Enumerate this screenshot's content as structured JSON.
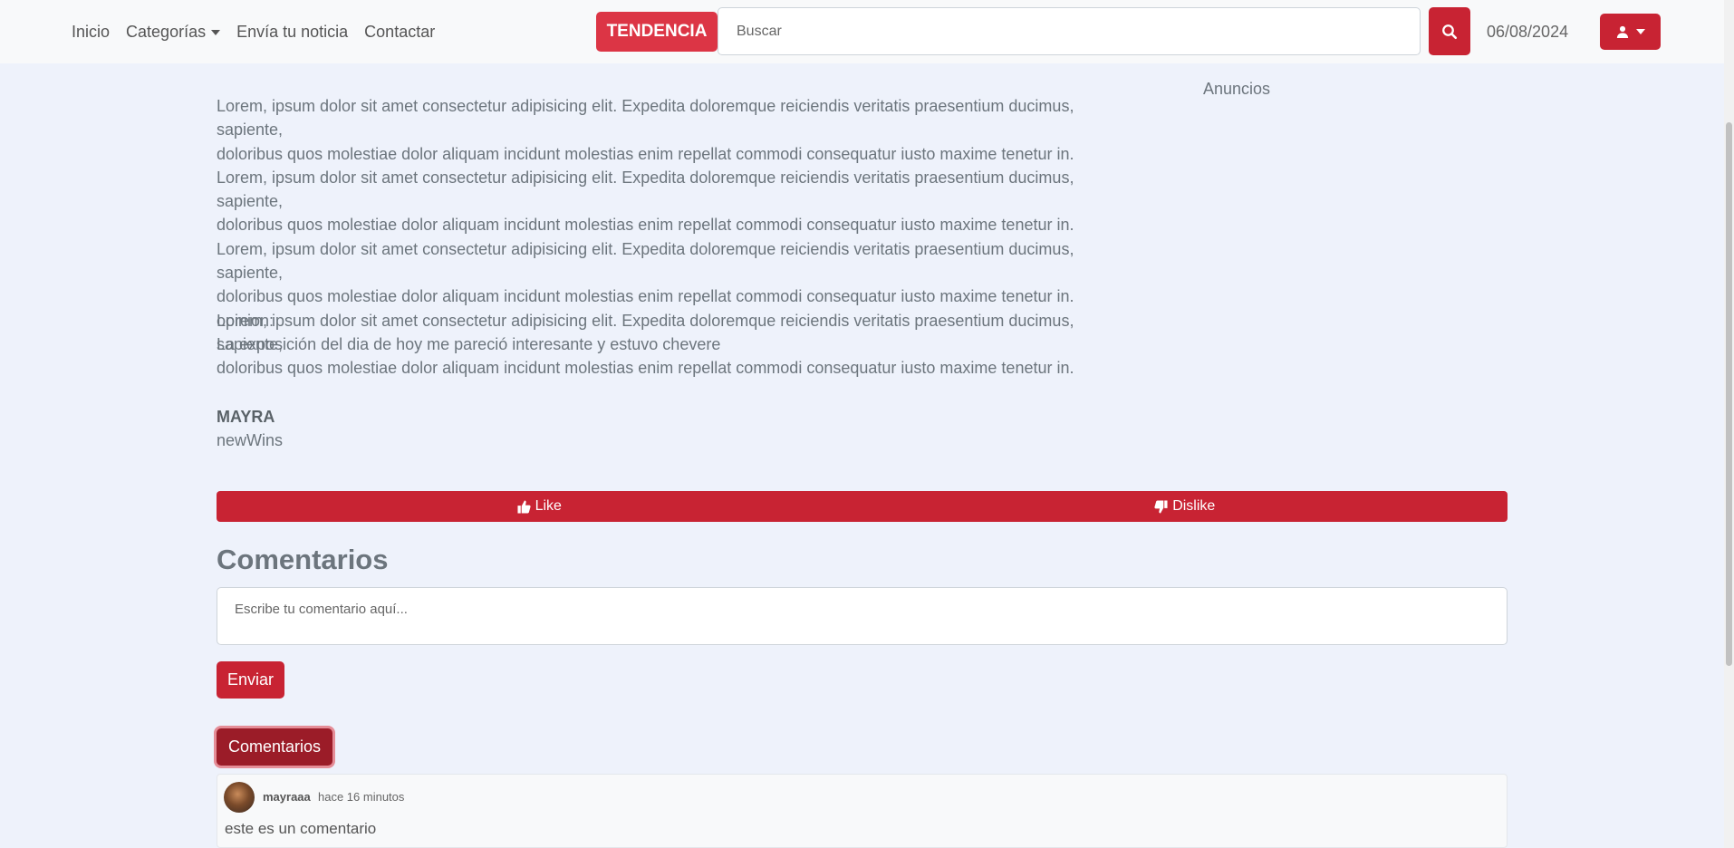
{
  "nav": {
    "links": [
      "Inicio",
      "Categorías",
      "Envía tu noticia",
      "Contactar"
    ],
    "trending_label": "TENDENCIA",
    "search_placeholder": "Buscar",
    "date": "06/08/2024"
  },
  "article": {
    "paragraph_lines": [
      "Lorem, ipsum dolor sit amet consectetur adipisicing elit. Expedita doloremque reiciendis veritatis praesentium ducimus, sapiente,",
      "doloribus quos molestiae dolor aliquam incidunt molestias enim repellat commodi consequatur iusto maxime tenetur in.",
      "Lorem, ipsum dolor sit amet consectetur adipisicing elit. Expedita doloremque reiciendis veritatis praesentium ducimus, sapiente,",
      "doloribus quos molestiae dolor aliquam incidunt molestias enim repellat commodi consequatur iusto maxime tenetur in.",
      "Lorem, ipsum dolor sit amet consectetur adipisicing elit. Expedita doloremque reiciendis veritatis praesentium ducimus, sapiente,",
      "doloribus quos molestiae dolor aliquam incidunt molestias enim repellat commodi consequatur iusto maxime tenetur in.",
      "Lorem, ipsum dolor sit amet consectetur adipisicing elit. Expedita doloremque reiciendis veritatis praesentium ducimus, sapiente,",
      "doloribus quos molestiae dolor aliquam incidunt molestias enim repellat commodi consequatur iusto maxime tenetur in."
    ],
    "opinion_label": "opinion:",
    "opinion_text": "La exposición del dia de hoy me pareció interesante y estuvo chevere",
    "author_name": "MAYRA",
    "author_org": "newWins"
  },
  "sidebar": {
    "ads_label": "Anuncios"
  },
  "reactions": {
    "like_label": "Like",
    "dislike_label": "Dislike"
  },
  "comments": {
    "title": "Comentarios",
    "placeholder": "Escribe tu comentario aquí...",
    "send_label": "Enviar",
    "toggle_label": "Comentarios",
    "items": [
      {
        "user": "mayraaa",
        "time": "hace 16 minutos",
        "text": "este es un comentario"
      }
    ]
  },
  "colors": {
    "brand": "#c82333",
    "trending": "#dc3545",
    "background": "#eef2fb"
  }
}
